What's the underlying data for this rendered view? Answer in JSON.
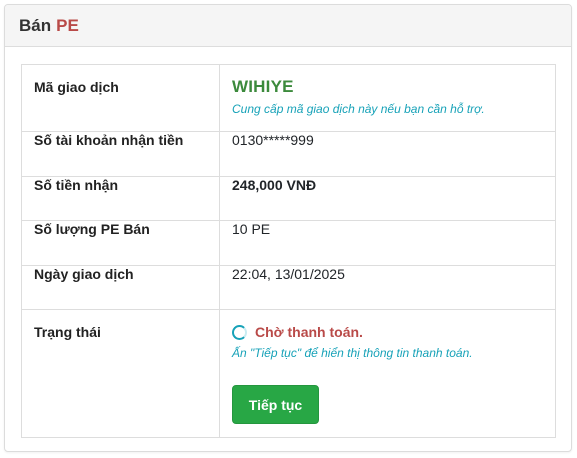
{
  "header": {
    "title": "Bán",
    "title_accent": "PE"
  },
  "rows": {
    "transaction_code": {
      "label": "Mã giao dịch",
      "value": "WIHIYE",
      "hint": "Cung cấp mã giao dịch này nếu bạn cần hỗ trợ."
    },
    "receive_account": {
      "label": "Số tài khoản nhận tiền",
      "value": "0130*****999"
    },
    "amount": {
      "label": "Số tiền nhận",
      "value": "248,000 VNĐ"
    },
    "quantity": {
      "label": "Số lượng PE Bán",
      "value": "10 PE"
    },
    "date": {
      "label": "Ngày giao dịch",
      "value": "22:04, 13/01/2025"
    },
    "status": {
      "label": "Trạng thái",
      "value": "Chờ thanh toán.",
      "hint": "Ấn \"Tiếp tục\" để hiển thị thông tin thanh toán.",
      "button": "Tiếp tục"
    }
  },
  "colors": {
    "accent_red": "#b94a48",
    "code_green": "#3c8a3c",
    "hint_teal": "#17a2b8",
    "button_green": "#28a745"
  },
  "icons": {
    "status": "loading-spinner-icon"
  }
}
